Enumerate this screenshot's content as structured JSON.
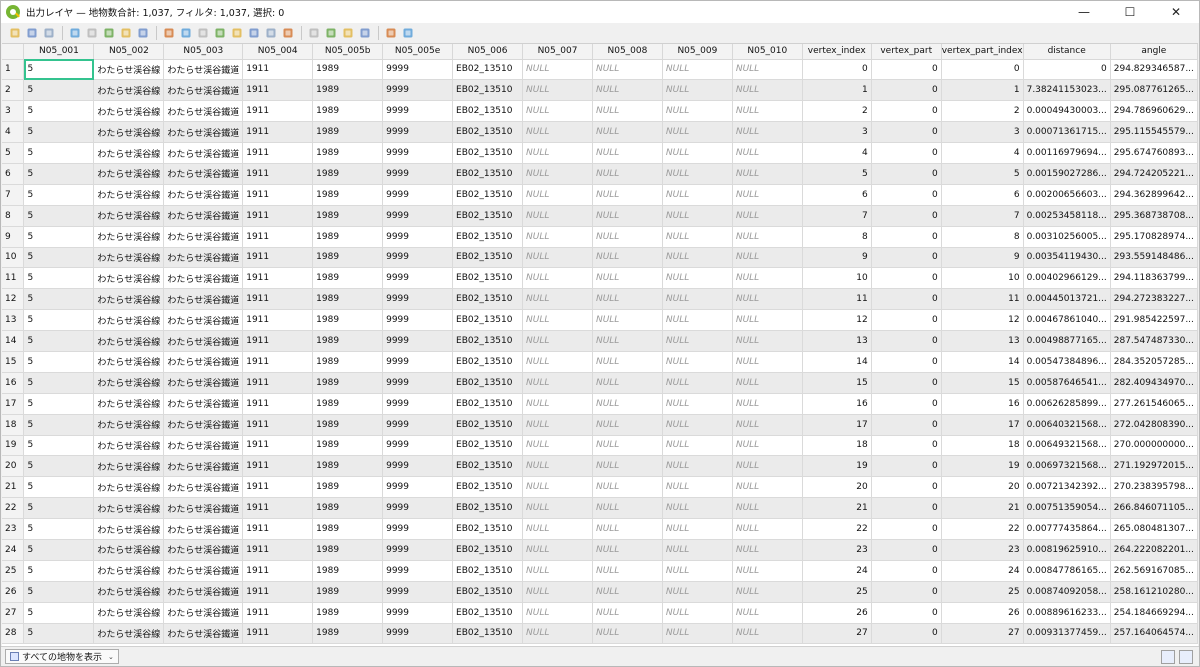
{
  "window": {
    "title": "出力レイヤ — 地物数合計: 1,037, フィルタ: 1,037, 選択: 0",
    "minimize_glyph": "—",
    "maximize_glyph": "☐",
    "close_glyph": "✕"
  },
  "toolbar": {
    "buttons": [
      {
        "name": "toggle-editing-icon"
      },
      {
        "name": "multi-edit-icon"
      },
      {
        "name": "save-edits-icon"
      },
      {
        "sep": true
      },
      {
        "name": "add-feature-icon"
      },
      {
        "name": "delete-feature-icon"
      },
      {
        "name": "cut-icon"
      },
      {
        "name": "copy-icon"
      },
      {
        "name": "paste-icon"
      },
      {
        "sep": true
      },
      {
        "name": "select-expression-icon"
      },
      {
        "name": "select-all-icon"
      },
      {
        "name": "invert-selection-icon"
      },
      {
        "name": "deselect-icon"
      },
      {
        "name": "filter-icon"
      },
      {
        "name": "move-selection-top-icon"
      },
      {
        "name": "pan-to-selection-icon"
      },
      {
        "name": "zoom-to-selection-icon"
      },
      {
        "sep": true
      },
      {
        "name": "new-field-icon"
      },
      {
        "name": "delete-field-icon"
      },
      {
        "name": "field-calculator-icon"
      },
      {
        "name": "conditional-format-icon"
      },
      {
        "sep": true
      },
      {
        "name": "actions-icon"
      },
      {
        "name": "dock-icon"
      }
    ]
  },
  "columns": [
    "N05_001",
    "N05_002",
    "N05_003",
    "N05_004",
    "N05_005b",
    "N05_005e",
    "N05_006",
    "N05_007",
    "N05_008",
    "N05_009",
    "N05_010",
    "vertex_index",
    "vertex_part",
    "vertex_part_index",
    "distance",
    "angle"
  ],
  "numeric_columns": [
    11,
    12,
    13,
    14
  ],
  "null_columns": [
    7,
    8,
    9,
    10
  ],
  "rows": [
    {
      "n": "1",
      "c": [
        "5",
        "わたらせ渓谷線",
        "わたらせ渓谷鐵道",
        "1911",
        "1989",
        "9999",
        "EB02_13510",
        "NULL",
        "NULL",
        "NULL",
        "NULL",
        "0",
        "0",
        "0",
        "0",
        "294.829346587..."
      ]
    },
    {
      "n": "2",
      "c": [
        "5",
        "わたらせ渓谷線",
        "わたらせ渓谷鐵道",
        "1911",
        "1989",
        "9999",
        "EB02_13510",
        "NULL",
        "NULL",
        "NULL",
        "NULL",
        "1",
        "0",
        "1",
        "7.38241153023...",
        "295.087761265..."
      ]
    },
    {
      "n": "3",
      "c": [
        "5",
        "わたらせ渓谷線",
        "わたらせ渓谷鐵道",
        "1911",
        "1989",
        "9999",
        "EB02_13510",
        "NULL",
        "NULL",
        "NULL",
        "NULL",
        "2",
        "0",
        "2",
        "0.00049430003...",
        "294.786960629..."
      ]
    },
    {
      "n": "4",
      "c": [
        "5",
        "わたらせ渓谷線",
        "わたらせ渓谷鐵道",
        "1911",
        "1989",
        "9999",
        "EB02_13510",
        "NULL",
        "NULL",
        "NULL",
        "NULL",
        "3",
        "0",
        "3",
        "0.00071361715...",
        "295.115545579..."
      ]
    },
    {
      "n": "5",
      "c": [
        "5",
        "わたらせ渓谷線",
        "わたらせ渓谷鐵道",
        "1911",
        "1989",
        "9999",
        "EB02_13510",
        "NULL",
        "NULL",
        "NULL",
        "NULL",
        "4",
        "0",
        "4",
        "0.00116979694...",
        "295.674760893..."
      ]
    },
    {
      "n": "6",
      "c": [
        "5",
        "わたらせ渓谷線",
        "わたらせ渓谷鐵道",
        "1911",
        "1989",
        "9999",
        "EB02_13510",
        "NULL",
        "NULL",
        "NULL",
        "NULL",
        "5",
        "0",
        "5",
        "0.00159027286...",
        "294.724205221..."
      ]
    },
    {
      "n": "7",
      "c": [
        "5",
        "わたらせ渓谷線",
        "わたらせ渓谷鐵道",
        "1911",
        "1989",
        "9999",
        "EB02_13510",
        "NULL",
        "NULL",
        "NULL",
        "NULL",
        "6",
        "0",
        "6",
        "0.00200656603...",
        "294.362899642..."
      ]
    },
    {
      "n": "8",
      "c": [
        "5",
        "わたらせ渓谷線",
        "わたらせ渓谷鐵道",
        "1911",
        "1989",
        "9999",
        "EB02_13510",
        "NULL",
        "NULL",
        "NULL",
        "NULL",
        "7",
        "0",
        "7",
        "0.00253458118...",
        "295.368738708..."
      ]
    },
    {
      "n": "9",
      "c": [
        "5",
        "わたらせ渓谷線",
        "わたらせ渓谷鐵道",
        "1911",
        "1989",
        "9999",
        "EB02_13510",
        "NULL",
        "NULL",
        "NULL",
        "NULL",
        "8",
        "0",
        "8",
        "0.00310256005...",
        "295.170828974..."
      ]
    },
    {
      "n": "10",
      "c": [
        "5",
        "わたらせ渓谷線",
        "わたらせ渓谷鐵道",
        "1911",
        "1989",
        "9999",
        "EB02_13510",
        "NULL",
        "NULL",
        "NULL",
        "NULL",
        "9",
        "0",
        "9",
        "0.00354119430...",
        "293.559148486..."
      ]
    },
    {
      "n": "11",
      "c": [
        "5",
        "わたらせ渓谷線",
        "わたらせ渓谷鐵道",
        "1911",
        "1989",
        "9999",
        "EB02_13510",
        "NULL",
        "NULL",
        "NULL",
        "NULL",
        "10",
        "0",
        "10",
        "0.00402966129...",
        "294.118363799..."
      ]
    },
    {
      "n": "12",
      "c": [
        "5",
        "わたらせ渓谷線",
        "わたらせ渓谷鐵道",
        "1911",
        "1989",
        "9999",
        "EB02_13510",
        "NULL",
        "NULL",
        "NULL",
        "NULL",
        "11",
        "0",
        "11",
        "0.00445013721...",
        "294.272383227..."
      ]
    },
    {
      "n": "13",
      "c": [
        "5",
        "わたらせ渓谷線",
        "わたらせ渓谷鐵道",
        "1911",
        "1989",
        "9999",
        "EB02_13510",
        "NULL",
        "NULL",
        "NULL",
        "NULL",
        "12",
        "0",
        "12",
        "0.00467861040...",
        "291.985422597..."
      ]
    },
    {
      "n": "14",
      "c": [
        "5",
        "わたらせ渓谷線",
        "わたらせ渓谷鐵道",
        "1911",
        "1989",
        "9999",
        "EB02_13510",
        "NULL",
        "NULL",
        "NULL",
        "NULL",
        "13",
        "0",
        "13",
        "0.00498877165...",
        "287.547487330..."
      ]
    },
    {
      "n": "15",
      "c": [
        "5",
        "わたらせ渓谷線",
        "わたらせ渓谷鐵道",
        "1911",
        "1989",
        "9999",
        "EB02_13510",
        "NULL",
        "NULL",
        "NULL",
        "NULL",
        "14",
        "0",
        "14",
        "0.00547384896...",
        "284.352057285..."
      ]
    },
    {
      "n": "16",
      "c": [
        "5",
        "わたらせ渓谷線",
        "わたらせ渓谷鐵道",
        "1911",
        "1989",
        "9999",
        "EB02_13510",
        "NULL",
        "NULL",
        "NULL",
        "NULL",
        "15",
        "0",
        "15",
        "0.00587646541...",
        "282.409434970..."
      ]
    },
    {
      "n": "17",
      "c": [
        "5",
        "わたらせ渓谷線",
        "わたらせ渓谷鐵道",
        "1911",
        "1989",
        "9999",
        "EB02_13510",
        "NULL",
        "NULL",
        "NULL",
        "NULL",
        "16",
        "0",
        "16",
        "0.00626285899...",
        "277.261546065..."
      ]
    },
    {
      "n": "18",
      "c": [
        "5",
        "わたらせ渓谷線",
        "わたらせ渓谷鐵道",
        "1911",
        "1989",
        "9999",
        "EB02_13510",
        "NULL",
        "NULL",
        "NULL",
        "NULL",
        "17",
        "0",
        "17",
        "0.00640321568...",
        "272.042808390..."
      ]
    },
    {
      "n": "19",
      "c": [
        "5",
        "わたらせ渓谷線",
        "わたらせ渓谷鐵道",
        "1911",
        "1989",
        "9999",
        "EB02_13510",
        "NULL",
        "NULL",
        "NULL",
        "NULL",
        "18",
        "0",
        "18",
        "0.00649321568...",
        "270.000000000..."
      ]
    },
    {
      "n": "20",
      "c": [
        "5",
        "わたらせ渓谷線",
        "わたらせ渓谷鐵道",
        "1911",
        "1989",
        "9999",
        "EB02_13510",
        "NULL",
        "NULL",
        "NULL",
        "NULL",
        "19",
        "0",
        "19",
        "0.00697321568...",
        "271.192972015..."
      ]
    },
    {
      "n": "21",
      "c": [
        "5",
        "わたらせ渓谷線",
        "わたらせ渓谷鐵道",
        "1911",
        "1989",
        "9999",
        "EB02_13510",
        "NULL",
        "NULL",
        "NULL",
        "NULL",
        "20",
        "0",
        "20",
        "0.00721342392...",
        "270.238395798..."
      ]
    },
    {
      "n": "22",
      "c": [
        "5",
        "わたらせ渓谷線",
        "わたらせ渓谷鐵道",
        "1911",
        "1989",
        "9999",
        "EB02_13510",
        "NULL",
        "NULL",
        "NULL",
        "NULL",
        "21",
        "0",
        "21",
        "0.00751359054...",
        "266.846071105..."
      ]
    },
    {
      "n": "23",
      "c": [
        "5",
        "わたらせ渓谷線",
        "わたらせ渓谷鐵道",
        "1911",
        "1989",
        "9999",
        "EB02_13510",
        "NULL",
        "NULL",
        "NULL",
        "NULL",
        "22",
        "0",
        "22",
        "0.00777435864...",
        "265.080481307..."
      ]
    },
    {
      "n": "24",
      "c": [
        "5",
        "わたらせ渓谷線",
        "わたらせ渓谷鐵道",
        "1911",
        "1989",
        "9999",
        "EB02_13510",
        "NULL",
        "NULL",
        "NULL",
        "NULL",
        "23",
        "0",
        "23",
        "0.00819625910...",
        "264.222082201..."
      ]
    },
    {
      "n": "25",
      "c": [
        "5",
        "わたらせ渓谷線",
        "わたらせ渓谷鐵道",
        "1911",
        "1989",
        "9999",
        "EB02_13510",
        "NULL",
        "NULL",
        "NULL",
        "NULL",
        "24",
        "0",
        "24",
        "0.00847786165...",
        "262.569167085..."
      ]
    },
    {
      "n": "26",
      "c": [
        "5",
        "わたらせ渓谷線",
        "わたらせ渓谷鐵道",
        "1911",
        "1989",
        "9999",
        "EB02_13510",
        "NULL",
        "NULL",
        "NULL",
        "NULL",
        "25",
        "0",
        "25",
        "0.00874092058...",
        "258.161210280..."
      ]
    },
    {
      "n": "27",
      "c": [
        "5",
        "わたらせ渓谷線",
        "わたらせ渓谷鐵道",
        "1911",
        "1989",
        "9999",
        "EB02_13510",
        "NULL",
        "NULL",
        "NULL",
        "NULL",
        "26",
        "0",
        "26",
        "0.00889616233...",
        "254.184669294..."
      ]
    },
    {
      "n": "28",
      "c": [
        "5",
        "わたらせ渓谷線",
        "わたらせ渓谷鐵道",
        "1911",
        "1989",
        "9999",
        "EB02_13510",
        "NULL",
        "NULL",
        "NULL",
        "NULL",
        "27",
        "0",
        "27",
        "0.00931377459...",
        "257.164064574..."
      ]
    }
  ],
  "statusbar": {
    "filter_label": "すべての地物を表示"
  },
  "colors": {
    "qgis_green": "#77b534",
    "selection_outline": "#34c38f",
    "alt_row": "#ebebeb",
    "null_text": "#9a9a9a"
  }
}
